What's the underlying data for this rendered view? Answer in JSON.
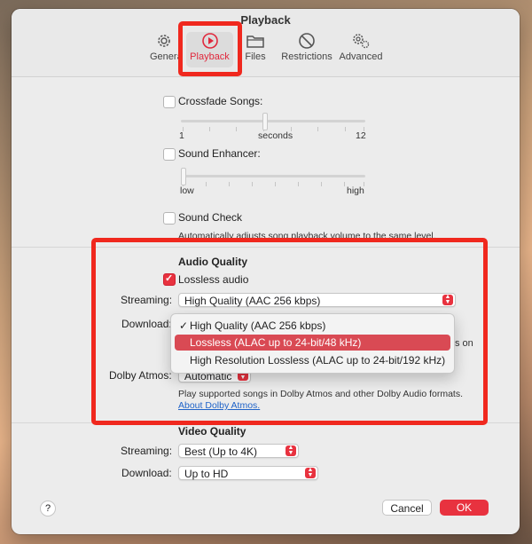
{
  "window": {
    "title": "Playback"
  },
  "toolbar": {
    "items": [
      {
        "label": "General",
        "icon": "gear-icon"
      },
      {
        "label": "Playback",
        "icon": "play-circle-icon"
      },
      {
        "label": "Files",
        "icon": "folder-icon"
      },
      {
        "label": "Restrictions",
        "icon": "prohibited-icon"
      },
      {
        "label": "Advanced",
        "icon": "gears-icon"
      }
    ],
    "selected": "Playback"
  },
  "crossfade": {
    "label": "Crossfade Songs:",
    "checked": false,
    "min": "1",
    "unit": "seconds",
    "max": "12"
  },
  "sound_enhancer": {
    "label": "Sound Enhancer:",
    "checked": false,
    "min": "low",
    "max": "high"
  },
  "sound_check": {
    "label": "Sound Check",
    "checked": false,
    "description": "Automatically adjusts song playback volume to the same level."
  },
  "audio_quality": {
    "title": "Audio Quality",
    "lossless": {
      "label": "Lossless audio",
      "checked": true
    },
    "streaming": {
      "label": "Streaming:",
      "value": "High Quality (AAC 256 kbps)"
    },
    "download": {
      "label": "Download:",
      "partial_text": "s on"
    },
    "dolby": {
      "label": "Dolby Atmos:",
      "value": "Automatic",
      "description": "Play supported songs in Dolby Atmos and other Dolby Audio formats.",
      "link": "About Dolby Atmos."
    },
    "menu": {
      "items": [
        {
          "label": "High Quality (AAC 256 kbps)",
          "checked": true
        },
        {
          "label": "Lossless (ALAC up to 24-bit/48 kHz)",
          "highlighted": true
        },
        {
          "label": "High Resolution Lossless (ALAC up to 24-bit/192 kHz)"
        }
      ],
      "check_glyph": "✓"
    }
  },
  "video_quality": {
    "title": "Video Quality",
    "streaming": {
      "label": "Streaming:",
      "value": "Best (Up to 4K)"
    },
    "download": {
      "label": "Download:",
      "value": "Up to HD"
    }
  },
  "footer": {
    "help": "?",
    "cancel": "Cancel",
    "ok": "OK"
  },
  "colors": {
    "accent": "#e8323f",
    "annotation": "#f0281e",
    "link": "#1f63c8"
  }
}
